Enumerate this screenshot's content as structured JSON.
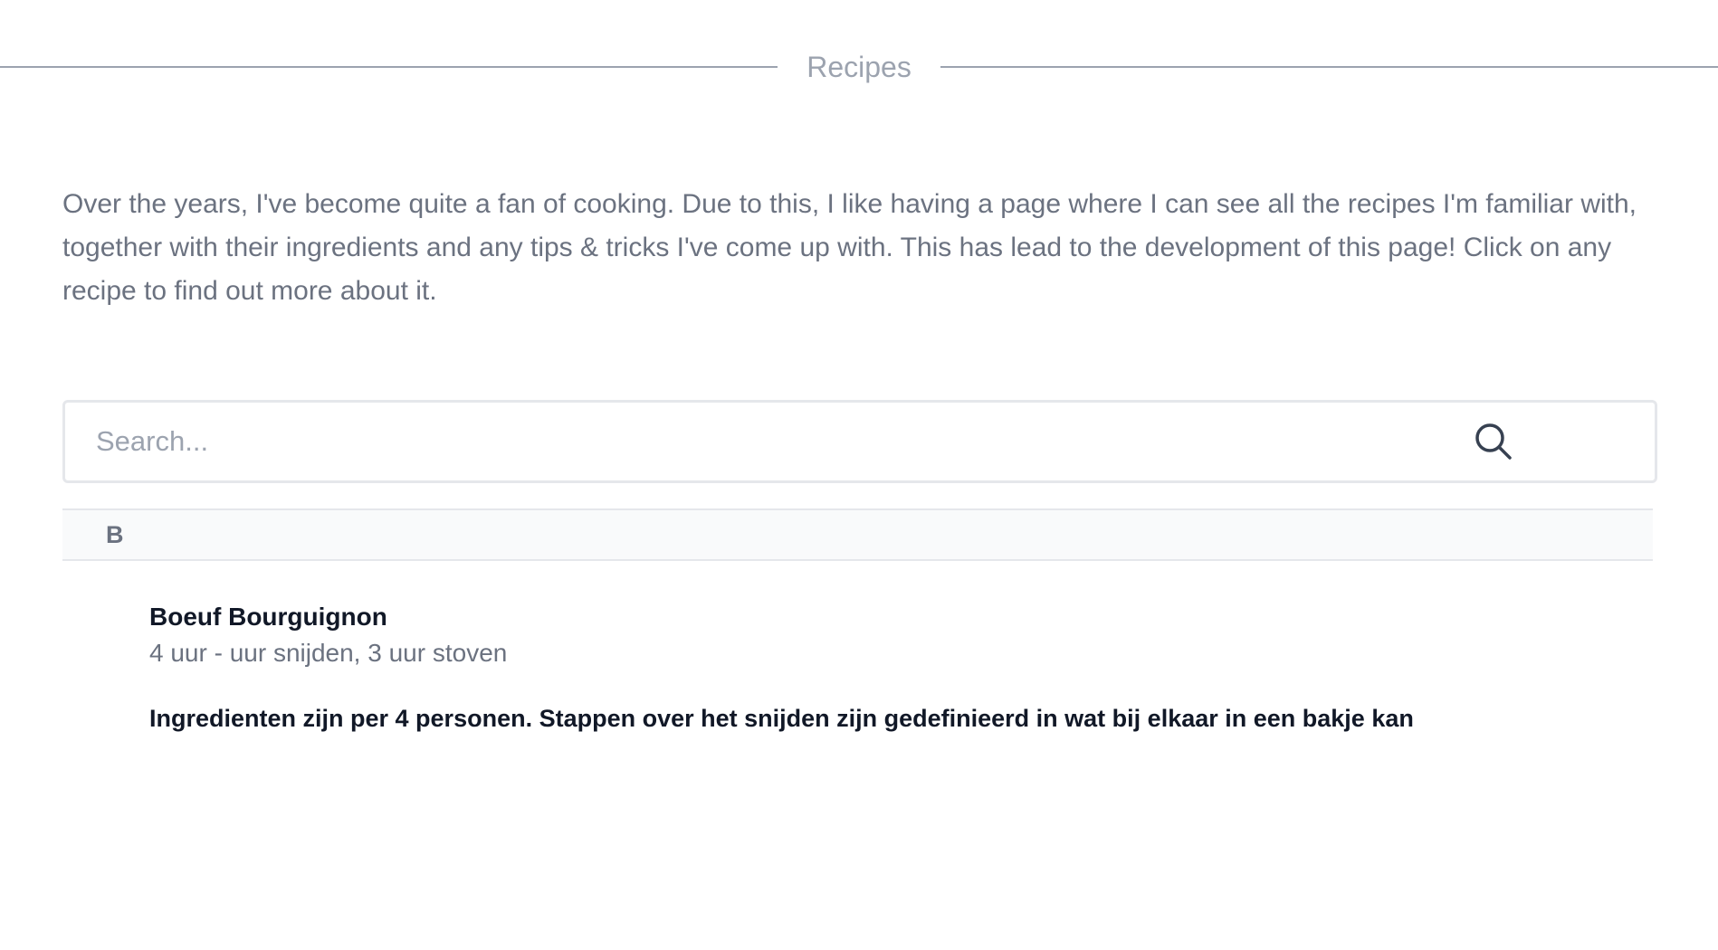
{
  "header": {
    "title": "Recipes"
  },
  "intro": {
    "text": "Over the years, I've become quite a fan of cooking. Due to this, I like having a page where I can see all the recipes I'm familiar with, together with their ingredients and any tips & tricks I've come up with. This has lead to the development of this page! Click on any recipe to find out more about it."
  },
  "search": {
    "placeholder": "Search...",
    "value": "",
    "icon": "search-icon"
  },
  "groups": [
    {
      "letter": "B",
      "recipes": [
        {
          "name": "Boeuf Bourguignon",
          "meta": "4 uur - uur snijden, 3 uur stoven",
          "description": "Ingredienten zijn per 4 personen. Stappen over het snijden zijn gedefinieerd in wat bij elkaar in een bakje kan"
        }
      ]
    }
  ],
  "colors": {
    "muted_text": "#6b7280",
    "light_text": "#9ca3af",
    "dark_text": "#111827",
    "border": "#e5e7eb",
    "group_bg": "#f9fafb"
  }
}
